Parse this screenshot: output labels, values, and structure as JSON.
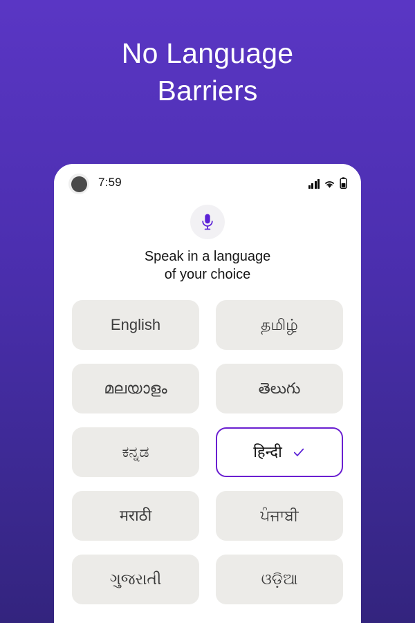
{
  "promo": {
    "headline_line1": "No Language",
    "headline_line2": "Barriers"
  },
  "colors": {
    "bg_gradient_top": "#5A36C4",
    "bg_gradient_bottom": "#33247E",
    "accent_purple": "#6A1FD0",
    "mic_purple": "#5B21D6",
    "chip_bg": "#ECEBE8",
    "chip_text": "#3C3C3C",
    "headline_text": "#FFFFFF"
  },
  "phone": {
    "status_bar": {
      "time": "7:59",
      "signal_icon": "cellular-signal-icon",
      "wifi_icon": "wifi-icon",
      "battery_icon": "battery-icon",
      "camera_icon": "camera-punch-hole"
    },
    "screen": {
      "mic_icon": "microphone-icon",
      "prompt_line1": "Speak in a language",
      "prompt_line2": "of your choice",
      "languages": [
        {
          "label": "English",
          "selected": false
        },
        {
          "label": "தமிழ்",
          "selected": false
        },
        {
          "label": "മലയാളം",
          "selected": false
        },
        {
          "label": "తెలుగు",
          "selected": false
        },
        {
          "label": "ಕನ್ನಡ",
          "selected": false
        },
        {
          "label": "हिन्दी",
          "selected": true
        },
        {
          "label": "मराठी",
          "selected": false
        },
        {
          "label": "ਪੰਜਾਬੀ",
          "selected": false
        },
        {
          "label": "ગુજરાતી",
          "selected": false
        },
        {
          "label": "ଓଡ଼ିଆ",
          "selected": false
        }
      ],
      "selected_check_icon": "check-icon"
    }
  }
}
